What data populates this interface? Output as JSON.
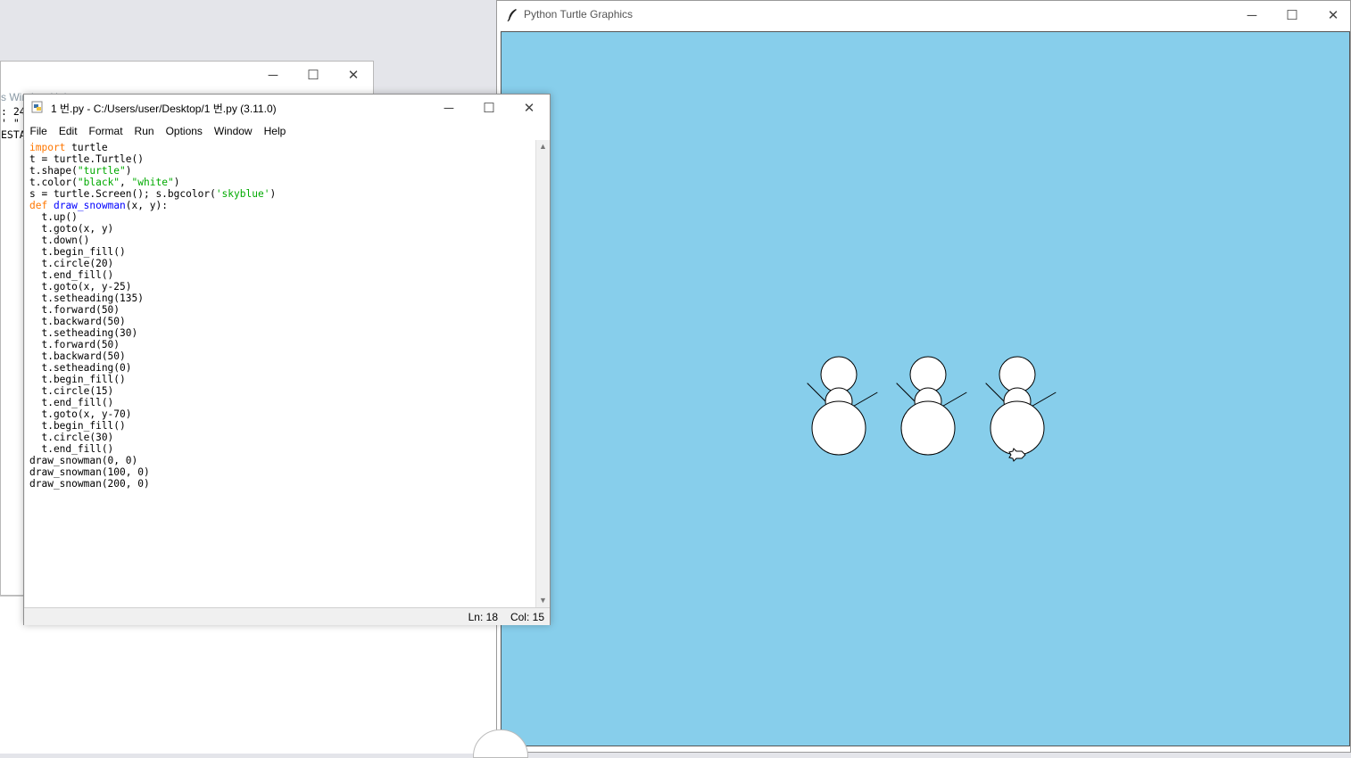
{
  "shell_window": {
    "menu_fragment": "s   Window   Help",
    "lines": [
      ": 24",
      "' \"",
      "ESTA"
    ]
  },
  "editor": {
    "title": "1 번.py - C:/Users/user/Desktop/1 번.py (3.11.0)",
    "menu": [
      "File",
      "Edit",
      "Format",
      "Run",
      "Options",
      "Window",
      "Help"
    ],
    "code_lines": [
      "import turtle",
      "t = turtle.Turtle()",
      "t.shape(\"turtle\")",
      "t.color(\"black\", \"white\")",
      "s = turtle.Screen(); s.bgcolor('skyblue')",
      "def draw_snowman(x, y):",
      "  t.up()",
      "  t.goto(x, y)",
      "  t.down()",
      "  t.begin_fill()",
      "  t.circle(20)",
      "  t.end_fill()",
      "  t.goto(x, y-25)",
      "  t.setheading(135)",
      "  t.forward(50)",
      "  t.backward(50)",
      "  t.setheading(30)",
      "  t.forward(50)",
      "  t.backward(50)",
      "  t.setheading(0)",
      "  t.begin_fill()",
      "  t.circle(15)",
      "  t.end_fill()",
      "  t.goto(x, y-70)",
      "  t.begin_fill()",
      "  t.circle(30)",
      "  t.end_fill()",
      "draw_snowman(0, 0)",
      "draw_snowman(100, 0)",
      "draw_snowman(200, 0)"
    ],
    "status_ln": "Ln: 18",
    "status_col": "Col: 15"
  },
  "turtle_window": {
    "title": "Python Turtle Graphics",
    "background_color": "#87ceeb",
    "snowmen_origin_x": [
      0,
      100,
      200
    ]
  },
  "icons": {
    "minimize": "─",
    "maximize": "☐",
    "close": "✕"
  }
}
